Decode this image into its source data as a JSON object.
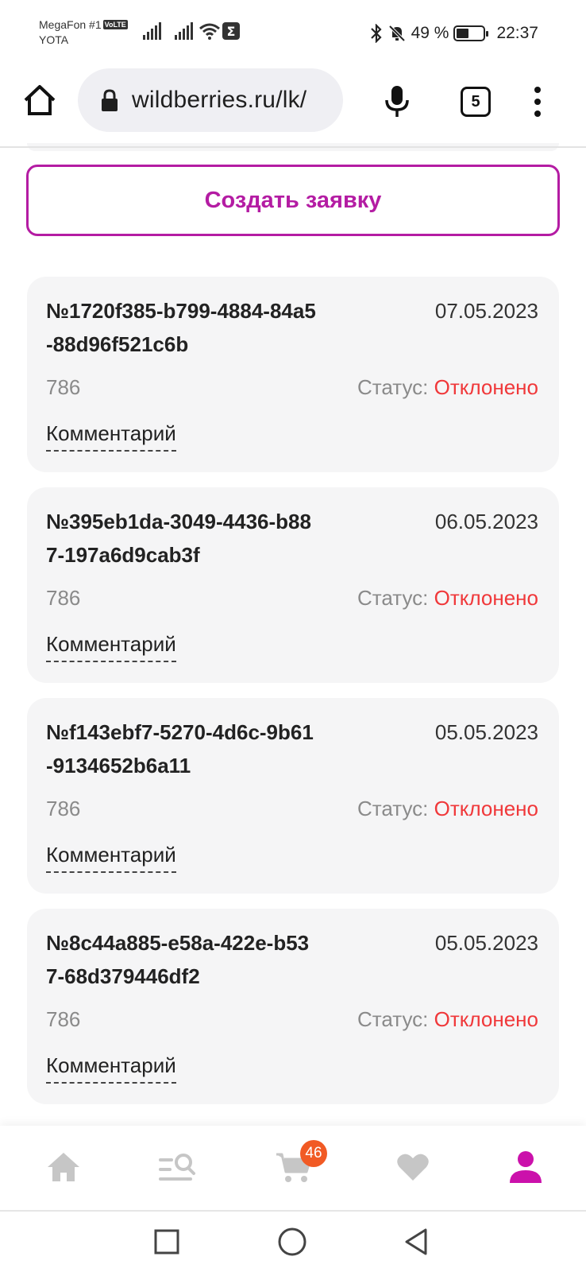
{
  "status_bar": {
    "carrier_1": "MegaFon #1",
    "volte": "VoLTE",
    "carrier_2": "YOTA",
    "battery_text": "49 %",
    "battery_level": 0.49,
    "time": "22:37"
  },
  "browser": {
    "url": "wildberries.ru/lk/",
    "tab_count": "5"
  },
  "create_button": "Создать заявку",
  "requests": [
    {
      "number": "№1720f385-b799-4884-84a5-88d96f521c6b",
      "date": "07.05.2023",
      "amount": "786",
      "status_label": "Статус:",
      "status": "Отклонено",
      "comment": "Комментарий"
    },
    {
      "number": "№395eb1da-3049-4436-b887-197a6d9cab3f",
      "date": "06.05.2023",
      "amount": "786",
      "status_label": "Статус:",
      "status": "Отклонено",
      "comment": "Комментарий"
    },
    {
      "number": "№f143ebf7-5270-4d6c-9b61-9134652b6a11",
      "date": "05.05.2023",
      "amount": "786",
      "status_label": "Статус:",
      "status": "Отклонено",
      "comment": "Комментарий"
    },
    {
      "number": "№8c44a885-e58a-422e-b537-68d379446df2",
      "date": "05.05.2023",
      "amount": "786",
      "status_label": "Статус:",
      "status": "Отклонено",
      "comment": "Комментарий"
    }
  ],
  "bottom_nav": {
    "cart_badge": "46",
    "icons": [
      "home-icon",
      "catalog-search-icon",
      "cart-icon",
      "heart-icon",
      "profile-icon"
    ],
    "active_color": "#cb11ab",
    "inactive_color": "#c6c6c6"
  },
  "colors": {
    "brand": "#b41ca3",
    "status_rejected": "#f0383a"
  }
}
